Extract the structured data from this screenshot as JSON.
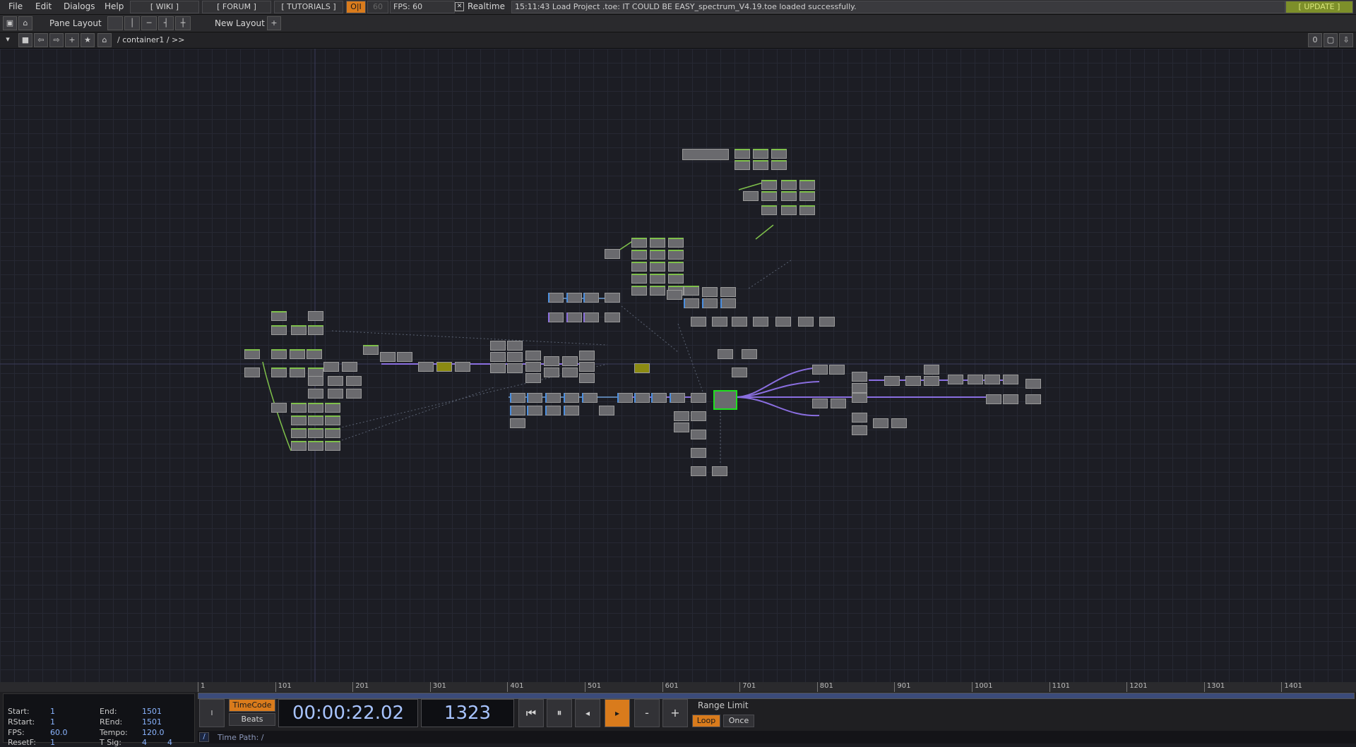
{
  "menu": {
    "file": "File",
    "edit": "Edit",
    "dialogs": "Dialogs",
    "help": "Help",
    "wiki": "[ WIKI ]",
    "forum": "[ FORUM ]",
    "tutorials": "[ TUTORIALS ]",
    "oi": "O|I",
    "fps_box": "60",
    "fps_label": "FPS:",
    "fps_value": "60",
    "realtime_label": "Realtime",
    "status": "15:11:43 Load Project .toe: IT COULD BE EASY_spectrum_V4.19.toe loaded successfully.",
    "update": "[ UPDATE ]"
  },
  "pane": {
    "pane_layout": "Pane Layout",
    "new_layout": "New Layout",
    "add": "+"
  },
  "path": {
    "crumb": "/ container1 / >>",
    "counter": "0"
  },
  "timeline": {
    "ticks": [
      "1",
      "101",
      "201",
      "301",
      "401",
      "501",
      "601",
      "701",
      "801",
      "901",
      "1001",
      "1101",
      "1201",
      "1301",
      "1401"
    ]
  },
  "info": {
    "start_label": "Start:",
    "start": "1",
    "end_label": "End:",
    "end": "1501",
    "rstart_label": "RStart:",
    "rstart": "1",
    "rend_label": "REnd:",
    "rend": "1501",
    "fps_label": "FPS:",
    "fps": "60.0",
    "tempo_label": "Tempo:",
    "tempo": "120.0",
    "resetf_label": "ResetF:",
    "resetf": "1",
    "tsig_label": "T Sig:",
    "tsig_a": "4",
    "tsig_b": "4"
  },
  "transport": {
    "timecode_label": "TimeCode",
    "beats_label": "Beats",
    "timecode": "00:00:22.02",
    "frame": "1323",
    "minus": "-",
    "plus": "+",
    "range_limit": "Range Limit",
    "loop": "Loop",
    "once": "Once",
    "timepath": "Time Path: /",
    "slash": "/"
  },
  "colors": {
    "accent": "#d97b1c",
    "selected": "#1fe01f",
    "link": "#8a6ee0",
    "value": "#8ab4ff"
  }
}
